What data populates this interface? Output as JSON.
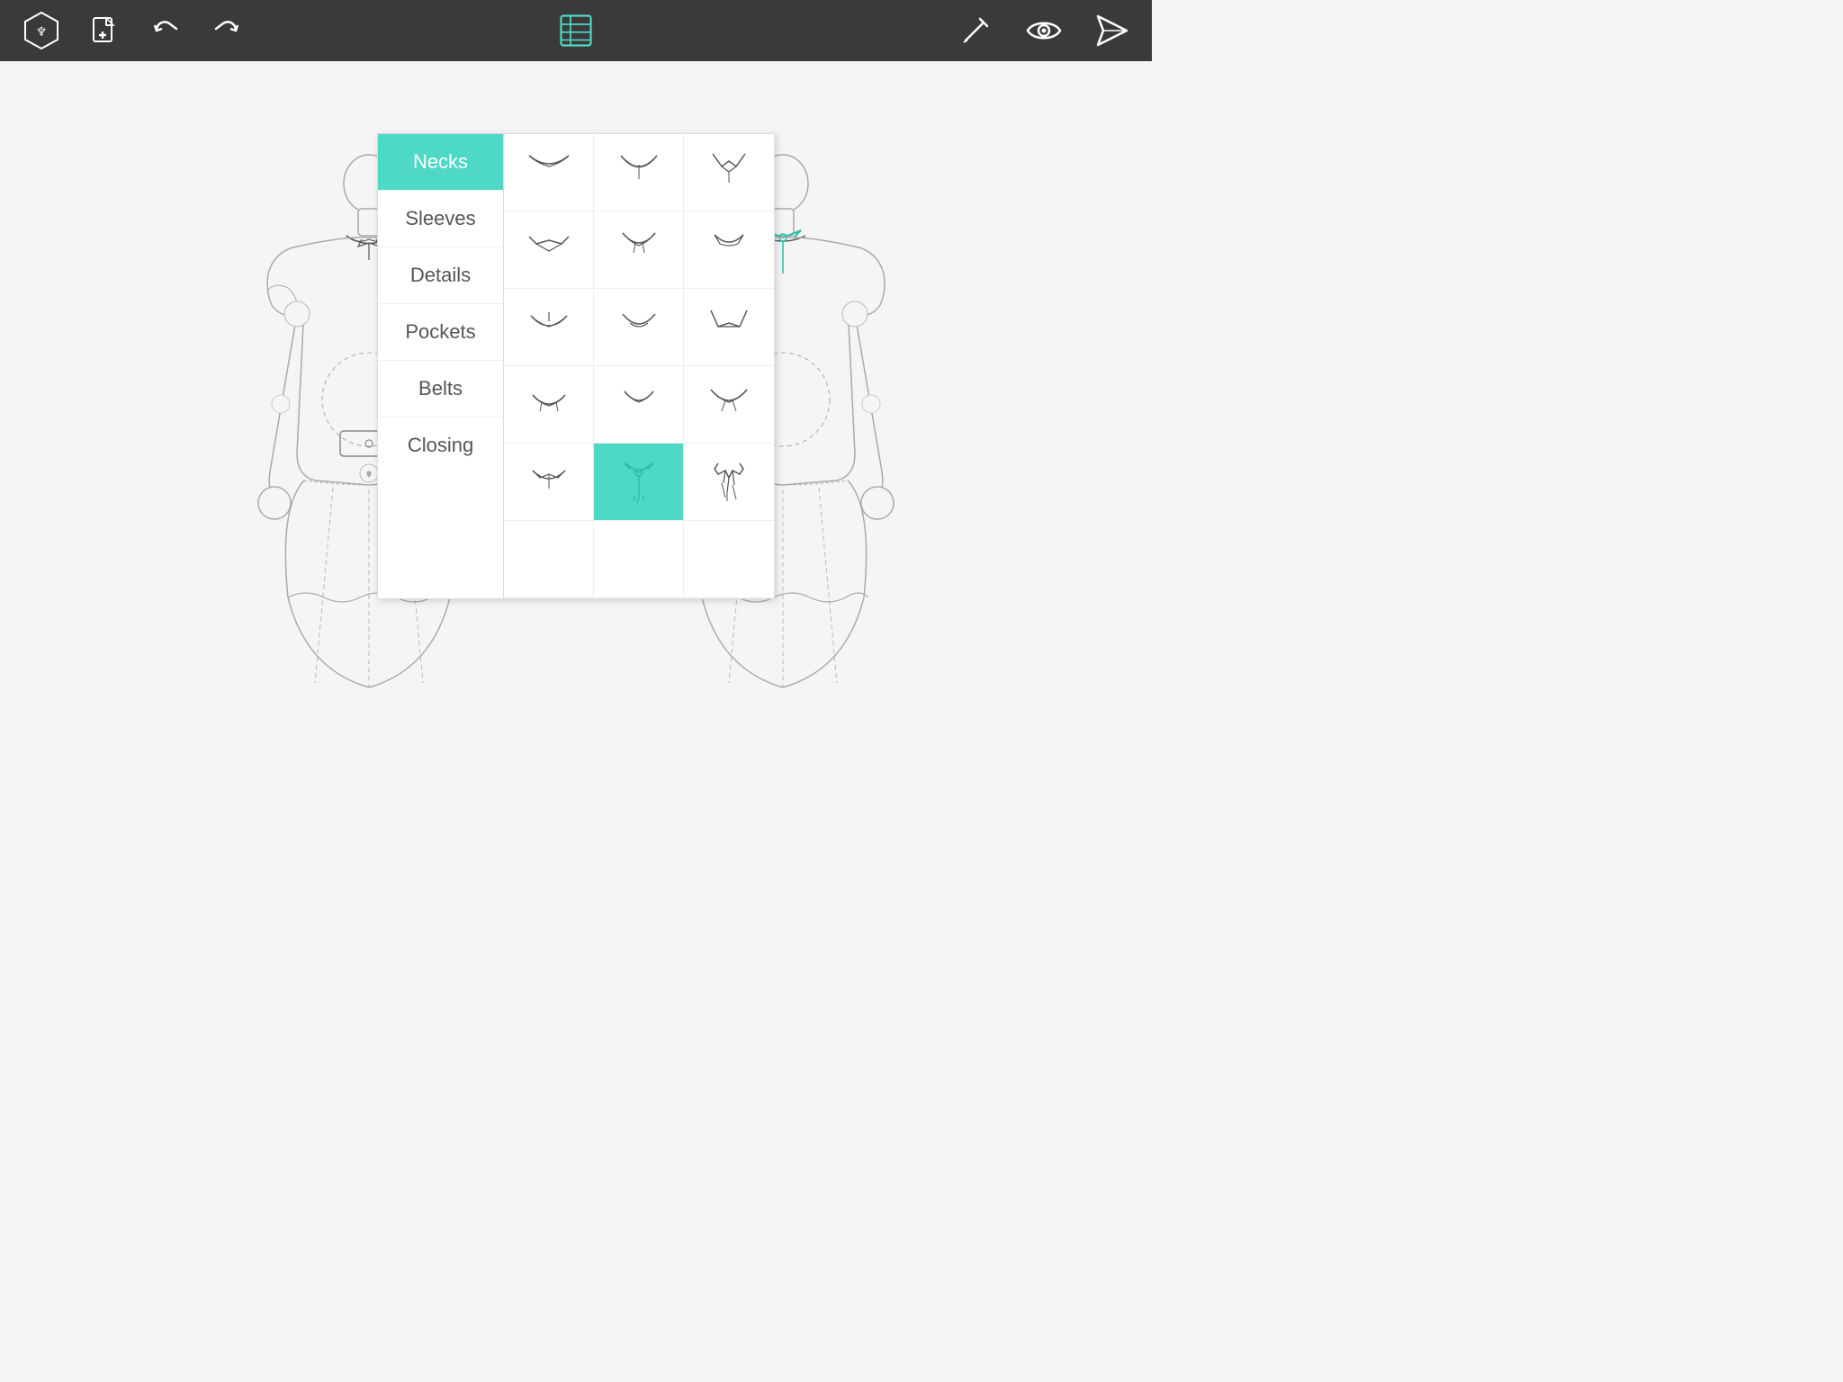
{
  "toolbar": {
    "logo_label": "logo",
    "new_label": "new",
    "undo_label": "undo",
    "redo_label": "redo",
    "list_label": "list",
    "edit_label": "edit",
    "preview_label": "preview",
    "send_label": "send"
  },
  "panel": {
    "categories": [
      {
        "id": "necks",
        "label": "Necks",
        "active": true
      },
      {
        "id": "sleeves",
        "label": "Sleeves",
        "active": false
      },
      {
        "id": "details",
        "label": "Details",
        "active": false
      },
      {
        "id": "pockets",
        "label": "Pockets",
        "active": false
      },
      {
        "id": "belts",
        "label": "Belts",
        "active": false
      },
      {
        "id": "closing",
        "label": "Closing",
        "active": false
      }
    ],
    "items_rows": 6,
    "items_cols": 3,
    "selected_row": 5,
    "selected_col": 1
  }
}
